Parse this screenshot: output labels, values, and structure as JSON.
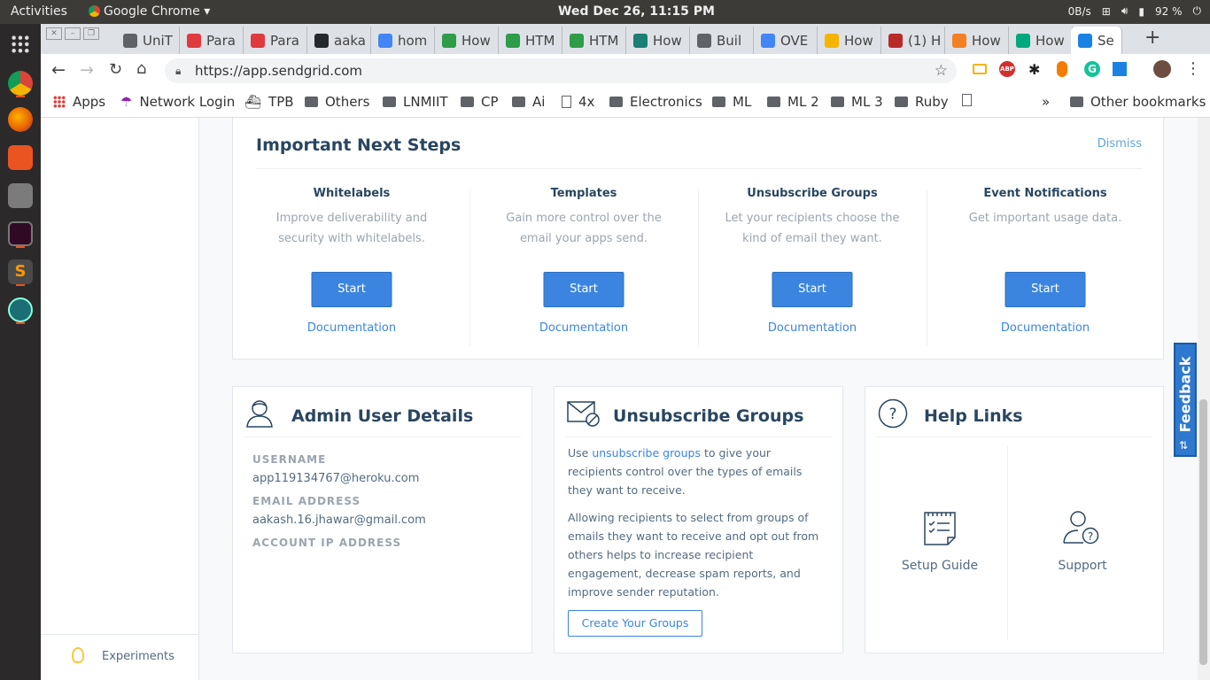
{
  "topbar": {
    "activities": "Activities",
    "app": "Google Chrome",
    "clock": "Wed Dec 26, 11:15 PM",
    "net": "0B/s",
    "battery": "92 %"
  },
  "tabs": [
    {
      "label": "UniT",
      "color": "#5f6368"
    },
    {
      "label": "Para",
      "color": "#e03a3e"
    },
    {
      "label": "Para",
      "color": "#e03a3e"
    },
    {
      "label": "aaka",
      "color": "#24292e"
    },
    {
      "label": "hom",
      "color": "#4285f4"
    },
    {
      "label": "How",
      "color": "#2e9c48"
    },
    {
      "label": "HTM",
      "color": "#2e9c48"
    },
    {
      "label": "HTM",
      "color": "#2e9c48"
    },
    {
      "label": "How",
      "color": "#1b7f73"
    },
    {
      "label": "Buil",
      "color": "#5f6368"
    },
    {
      "label": "OVE",
      "color": "#4285f4"
    },
    {
      "label": "How",
      "color": "#f4b400"
    },
    {
      "label": "(1) H",
      "color": "#b92b27"
    },
    {
      "label": "How",
      "color": "#f48024"
    },
    {
      "label": "How",
      "color": "#00a87e"
    },
    {
      "label": "Se",
      "color": "#1a82e2"
    }
  ],
  "omnibox": {
    "url": "https://app.sendgrid.com"
  },
  "bookmarks": {
    "items": [
      "Apps",
      "Network Login",
      "TPB",
      "Others",
      "LNMIIT",
      "CP",
      "Ai",
      "4x",
      "Electronics",
      "ML",
      "ML 2",
      "ML 3",
      "Ruby"
    ],
    "overflow": "»",
    "other": "Other bookmarks"
  },
  "sidebar": {
    "experiments": "Experiments"
  },
  "next_steps": {
    "title": "Important Next Steps",
    "dismiss": "Dismiss",
    "steps": [
      {
        "title": "Whitelabels",
        "desc": "Improve deliverability and security with whitelabels.",
        "button": "Start",
        "doc": "Documentation"
      },
      {
        "title": "Templates",
        "desc": "Gain more control over the email your apps send.",
        "button": "Start",
        "doc": "Documentation"
      },
      {
        "title": "Unsubscribe Groups",
        "desc": "Let your recipients choose the kind of email they want.",
        "button": "Start",
        "doc": "Documentation"
      },
      {
        "title": "Event Notifications",
        "desc": "Get important usage data.",
        "button": "Start",
        "doc": "Documentation"
      }
    ]
  },
  "admin": {
    "title": "Admin User Details",
    "username_label": "USERNAME",
    "username": "app119134767@heroku.com",
    "email_label": "EMAIL ADDRESS",
    "email": "aakash.16.jhawar@gmail.com",
    "ip_label": "ACCOUNT IP ADDRESS"
  },
  "unsub": {
    "title": "Unsubscribe Groups",
    "p1_pre": "Use ",
    "p1_link": "unsubscribe groups",
    "p1_post": " to give your recipients control over the types of emails they want to receive.",
    "p2": "Allowing recipients to select from groups of emails they want to receive and opt out from others helps to increase recipient engagement, decrease spam reports, and improve sender reputation.",
    "button": "Create Your Groups"
  },
  "help": {
    "title": "Help Links",
    "setup": "Setup Guide",
    "support": "Support"
  },
  "feedback": "Feedback"
}
